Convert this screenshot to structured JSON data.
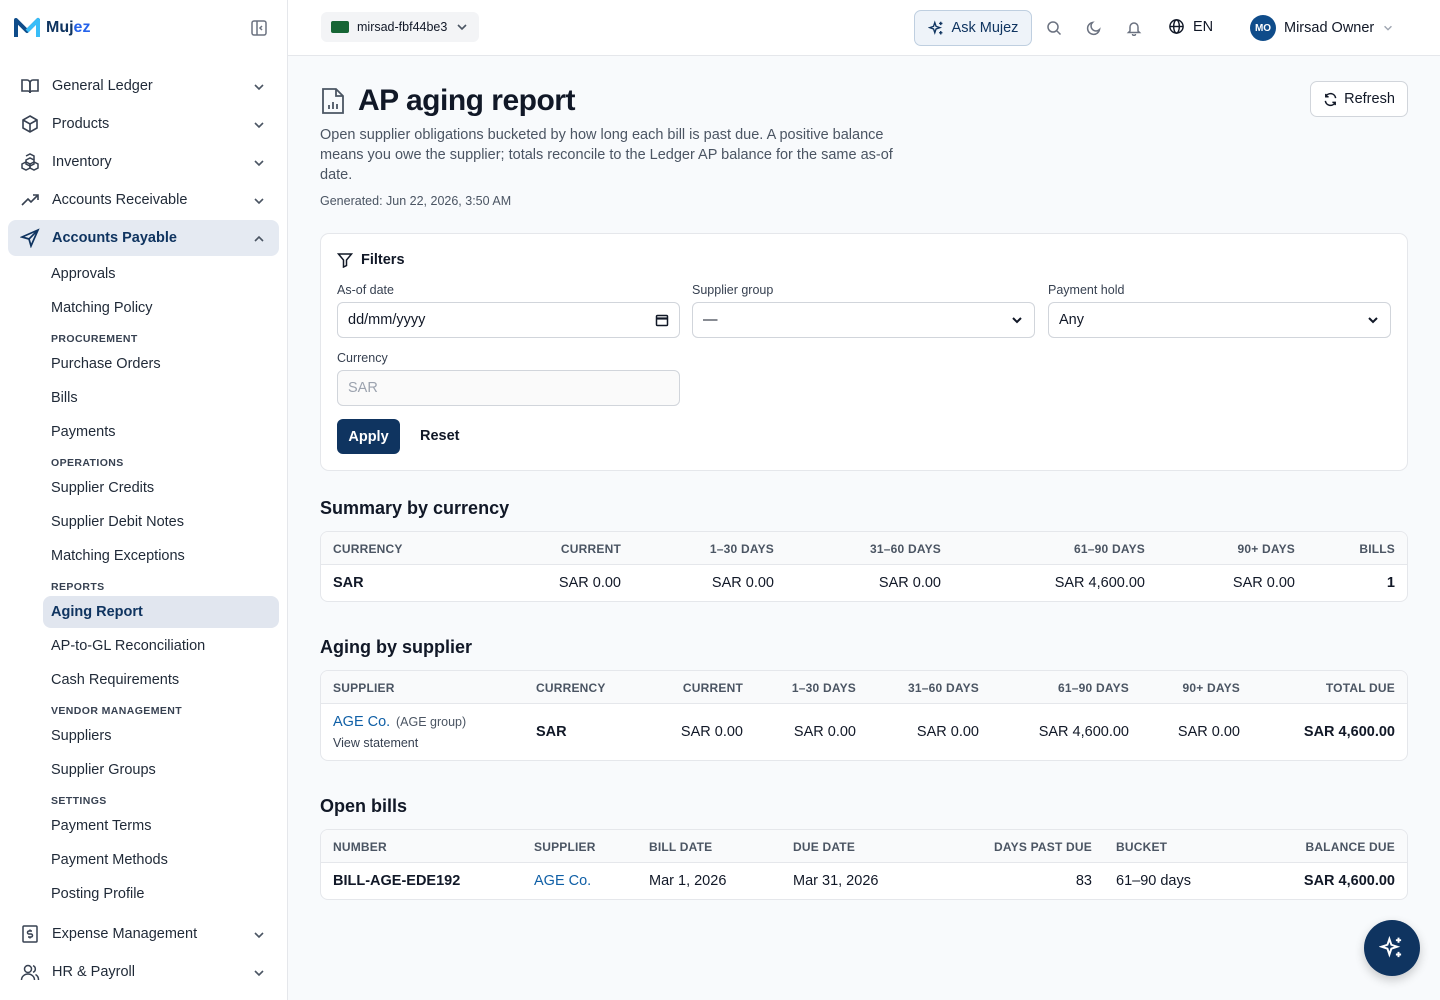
{
  "brand": {
    "name_prefix": "Muj",
    "name_suffix": "ez"
  },
  "sidebar": {
    "groups_top": [
      {
        "label": "General Ledger",
        "icon": "book-icon"
      },
      {
        "label": "Products",
        "icon": "box-icon"
      },
      {
        "label": "Inventory",
        "icon": "boxes-icon"
      },
      {
        "label": "Accounts Receivable",
        "icon": "trend-up-icon"
      }
    ],
    "active_group": {
      "label": "Accounts Payable",
      "icon": "send-icon"
    },
    "items": {
      "approvals": "Approvals",
      "matching_policy": "Matching Policy",
      "procurement": "PROCUREMENT",
      "purchase_orders": "Purchase Orders",
      "bills": "Bills",
      "payments": "Payments",
      "operations": "OPERATIONS",
      "supplier_credits": "Supplier Credits",
      "supplier_debit_notes": "Supplier Debit Notes",
      "matching_exceptions": "Matching Exceptions",
      "reports": "REPORTS",
      "aging_report": "Aging Report",
      "ap_gl": "AP-to-GL Reconciliation",
      "cash_requirements": "Cash Requirements",
      "vendor_management": "VENDOR MANAGEMENT",
      "suppliers": "Suppliers",
      "supplier_groups": "Supplier Groups",
      "settings": "SETTINGS",
      "payment_terms": "Payment Terms",
      "payment_methods": "Payment Methods",
      "posting_profile": "Posting Profile"
    },
    "groups_bottom": [
      {
        "label": "Expense Management",
        "icon": "receipt-icon"
      },
      {
        "label": "HR & Payroll",
        "icon": "users-icon"
      }
    ]
  },
  "topbar": {
    "org": "mirsad-fbf44be3",
    "ask": "Ask Mujez",
    "lang": "EN",
    "user_initials": "MO",
    "user_name": "Mirsad Owner"
  },
  "page": {
    "title": "AP aging report",
    "refresh": "Refresh",
    "description": "Open supplier obligations bucketed by how long each bill is past due. A positive balance means you owe the supplier; totals reconcile to the Ledger AP balance for the same as-of date.",
    "generated": "Generated: Jun 22, 2026, 3:50 AM"
  },
  "filters": {
    "title": "Filters",
    "as_of_label": "As-of date",
    "as_of_value": "dd/mm/yyyy",
    "supplier_group_label": "Supplier group",
    "supplier_group_value": "—",
    "payment_hold_label": "Payment hold",
    "payment_hold_value": "Any",
    "currency_label": "Currency",
    "currency_placeholder": "SAR",
    "apply": "Apply",
    "reset": "Reset"
  },
  "summary": {
    "title": "Summary by currency",
    "headers": {
      "currency": "CURRENCY",
      "current": "CURRENT",
      "d1_30": "1–30 DAYS",
      "d31_60": "31–60 DAYS",
      "d61_90": "61–90 DAYS",
      "d90": "90+ DAYS",
      "bills": "BILLS"
    },
    "rows": [
      {
        "currency": "SAR",
        "current": "SAR 0.00",
        "d1_30": "SAR 0.00",
        "d31_60": "SAR 0.00",
        "d61_90": "SAR 4,600.00",
        "d90": "SAR 0.00",
        "bills": "1"
      }
    ]
  },
  "by_supplier": {
    "title": "Aging by supplier",
    "headers": {
      "supplier": "SUPPLIER",
      "currency": "CURRENCY",
      "current": "CURRENT",
      "d1_30": "1–30 DAYS",
      "d31_60": "31–60 DAYS",
      "d61_90": "61–90 DAYS",
      "d90": "90+ DAYS",
      "total": "TOTAL DUE"
    },
    "rows": [
      {
        "supplier": "AGE Co.",
        "group": "(AGE group)",
        "statement": "View statement",
        "currency": "SAR",
        "current": "SAR 0.00",
        "d1_30": "SAR 0.00",
        "d31_60": "SAR 0.00",
        "d61_90": "SAR 4,600.00",
        "d90": "SAR 0.00",
        "total": "SAR 4,600.00"
      }
    ]
  },
  "open_bills": {
    "title": "Open bills",
    "headers": {
      "number": "NUMBER",
      "supplier": "SUPPLIER",
      "bill_date": "BILL DATE",
      "due_date": "DUE DATE",
      "days": "DAYS PAST DUE",
      "bucket": "BUCKET",
      "balance": "BALANCE DUE"
    },
    "rows": [
      {
        "number": "BILL-AGE-EDE192",
        "supplier": "AGE Co.",
        "bill_date": "Mar 1, 2026",
        "due_date": "Mar 31, 2026",
        "days": "83",
        "bucket": "61–90 days",
        "balance": "SAR 4,600.00"
      }
    ]
  },
  "colors": {
    "brand": "#0f3460",
    "link": "#0f5fa6",
    "active_bg": "#e5eaf2"
  }
}
